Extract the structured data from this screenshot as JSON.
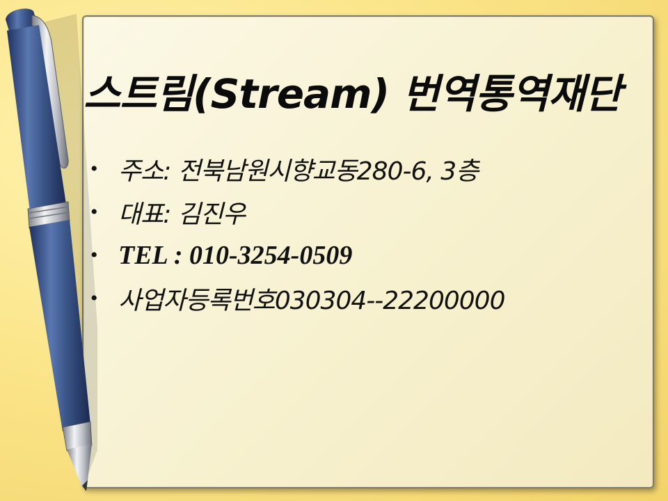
{
  "slide": {
    "title": "스트림(Stream) 번역통역재단",
    "bullet_symbol": "•",
    "bullets": [
      {
        "text": "주소: 전북남원시향교동280-6, 3층"
      },
      {
        "text": "대표: 김진우"
      },
      {
        "text": "TEL : 010-3254-0509"
      },
      {
        "text": "사업자등록번호030304--22200000"
      }
    ]
  },
  "colors": {
    "background": "#f7e08a",
    "card": "#f8f4d8",
    "pen_body": "#3c5689",
    "pen_metal": "#c9ccd0",
    "text": "#111111"
  },
  "icons": {
    "pen": "pen-illustration"
  }
}
